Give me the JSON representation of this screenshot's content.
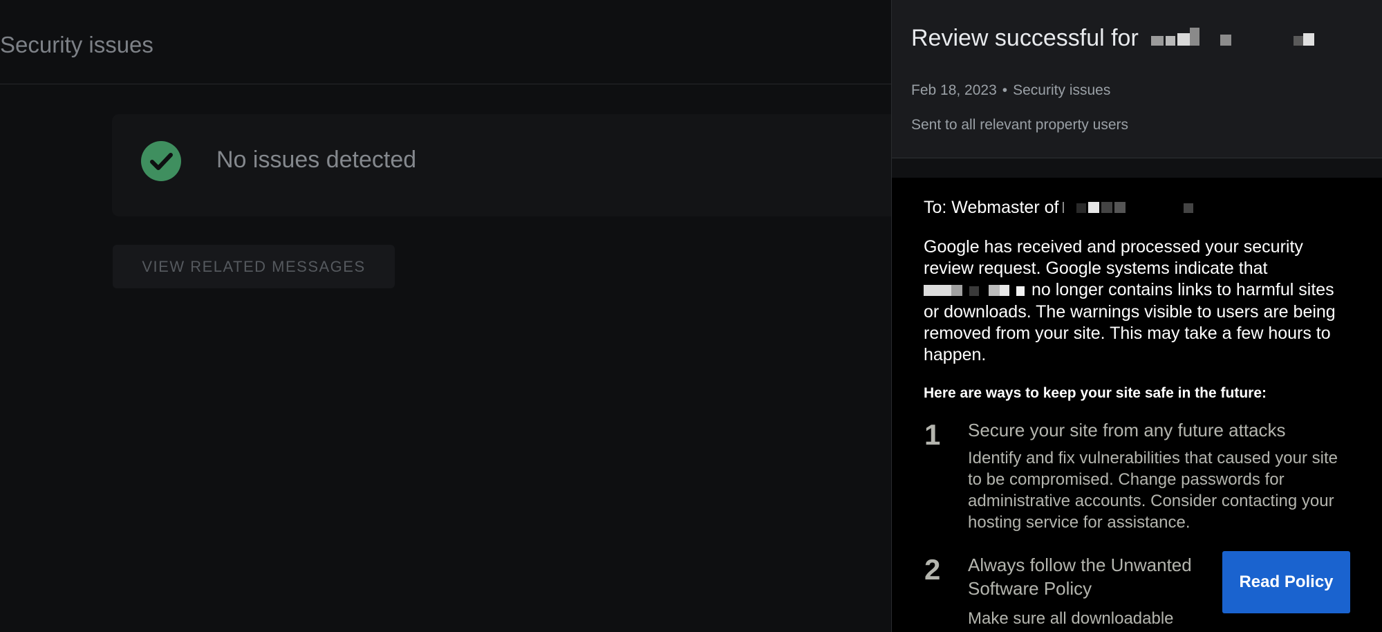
{
  "main": {
    "page_title": "Security issues",
    "status_text": "No issues detected",
    "related_button_label": "VIEW RELATED MESSAGES",
    "colors": {
      "check_green": "#3f8f5f"
    }
  },
  "panel": {
    "title_prefix": "Review successful for",
    "date": "Feb 18, 2023",
    "separator": "•",
    "category": "Security issues",
    "recipients": "Sent to all relevant property users",
    "email": {
      "to_prefix": "To: Webmaster of",
      "para_text": "no longer contains links to harmful sites or downloads. The warnings visible to users are being removed from your site. This may take a few hours to happen.",
      "para_lead": "Google has received and processed your security review request. Google systems indicate that",
      "tips_heading": "Here are ways to keep your site safe in the future:",
      "tips": [
        {
          "number": "1",
          "title": "Secure your site from any future attacks",
          "description": "Identify and fix vulnerabilities that caused your site to be compromised. Change passwords for administrative accounts. Consider contacting your hosting service for assistance."
        },
        {
          "number": "2",
          "title": "Always follow the Unwanted Software Policy",
          "description": "Make sure all downloadable"
        }
      ],
      "policy_button_label": "Read Policy"
    },
    "colors": {
      "accent_blue": "#1a63cf"
    }
  }
}
